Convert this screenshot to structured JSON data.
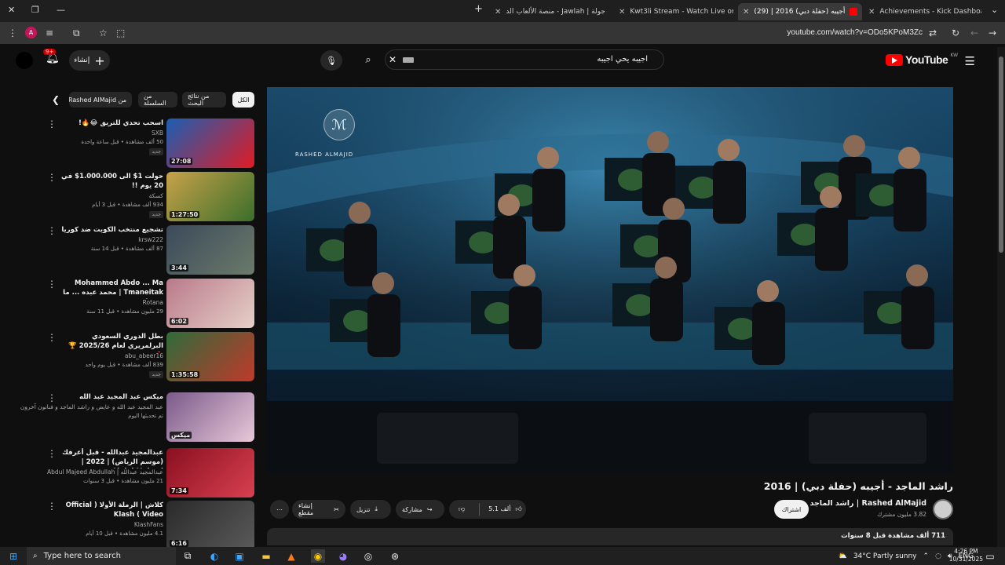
{
  "browser": {
    "tabs": [
      {
        "title": "Achievements - Kick Dashboard",
        "favicon_color": "#53fc18"
      },
      {
        "title": "أجيبه (حفلة دبي) 2016 | (29)",
        "favicon_color": "#ff0000"
      },
      {
        "title": "Kwt3li Stream - Watch Live on I",
        "favicon_color": "#53fc18"
      },
      {
        "title": "جولة | Jawlah - منصة الألعاب الد",
        "favicon_color": "#dddddd"
      }
    ],
    "new_tab": "+",
    "url": "youtube.com/watch?v=ODo5KPoM3Zc",
    "profile_initial": "A"
  },
  "header": {
    "logo_text": "YouTube",
    "country_code": "KW",
    "search_query": "اجيبه يحي اجيبه",
    "create_label": "إنشاء",
    "notif_count": "9+"
  },
  "chips": [
    "الكل",
    "من نتائج البحث",
    "من السلسلة",
    "من Rashed AlMajid"
  ],
  "recommendations": [
    {
      "title": "اسحب تحدي للتريق 😂🔥!",
      "channel": "SXB",
      "meta": "50 ألف مشاهدة • قبل ساعة واحدة",
      "new": "جديد",
      "duration": "27:08",
      "colors": [
        "#1a5fb4",
        "#e01b24"
      ]
    },
    {
      "title": "حولت 1$ الى 1.000.000$ في 20 يوم !!",
      "channel": "كسكة",
      "meta": "934 ألف مشاهدة • قبل 3 أيام",
      "new": "جديد",
      "duration": "1:27:50",
      "colors": [
        "#c8a24a",
        "#3a6e2a"
      ]
    },
    {
      "title": "تشجيع منتخب الكويت ضد كوريا",
      "channel": "krsw222",
      "meta": "87 ألف مشاهدة • قبل 14 سنة",
      "new": "",
      "duration": "3:44",
      "colors": [
        "#3b4a5a",
        "#6b7a6a"
      ]
    },
    {
      "title": "Mohammed Abdo ... Ma Tmaneitak | محمد عبده ... ما تمنيتك",
      "channel": "Rotana",
      "meta": "29 مليون مشاهدة • قبل 11 سنة",
      "new": "",
      "duration": "6:02",
      "colors": [
        "#b97a8a",
        "#e6d0c8"
      ]
    },
    {
      "title": "بطل الدوري السعودي البرلمريري لعام 2025/26 🏆🔥",
      "channel": "abu_abeer16",
      "meta": "839 ألف مشاهدة • قبل يوم واحد",
      "new": "جديد",
      "duration": "1:35:58",
      "colors": [
        "#2f6b3a",
        "#c0392b"
      ]
    },
    {
      "title": "ميكس عبد المجيد عبد الله",
      "channel": "عبد المجيد عبد الله و عايض و راشد الماجد و فنانون آخرون",
      "meta": "تم تحديثها اليوم",
      "new": "",
      "duration": "ميكس",
      "colors": [
        "#7a5a8a",
        "#e8c8d8"
      ]
    },
    {
      "title": "عبدالمجيد عبدالله - قبل أعرفك (موسم الرياض) | 2022 | Abdul Majeed",
      "channel": "عبدالمجيد عبدالله | Abdul Majeed Abdullah",
      "meta": "21 مليون مشاهدة • قبل 3 سنوات",
      "new": "",
      "duration": "7:34",
      "colors": [
        "#8a1020",
        "#d84050"
      ]
    },
    {
      "title": "كلاش | الرملة الأولا ( Official Video ) Klash",
      "channel": "KlashFans",
      "meta": "4.1 مليون مشاهدة • قبل 10 أيام",
      "new": "",
      "duration": "6:16",
      "colors": [
        "#2a2a2a",
        "#5a5a5a"
      ]
    }
  ],
  "video": {
    "title": "راشد الماجد - أجيبه (حفلة دبي) | 2016",
    "watermark": "RASHED ALMAJID",
    "channel_name": "Rashed AlMajid | راشد الماجد",
    "subscribers": "3.82 مليون مشترك",
    "subscribe_label": "اشتراك",
    "likes": "5.1 ألف",
    "share_label": "مشاركة",
    "download_label": "تنزيل",
    "clip_label": "إنشاء مقطع",
    "description_meta": "711 ألف مشاهدة قبل 8 سنوات"
  },
  "taskbar": {
    "search_placeholder": "Type here to search",
    "weather": "34°C  Partly sunny",
    "lang": "ENG",
    "time": "4:26 PM",
    "date": "10/31/2025"
  },
  "colors": {
    "yt_red": "#ff0000",
    "bg": "#0f0f0f",
    "chip_bg": "#272727"
  }
}
